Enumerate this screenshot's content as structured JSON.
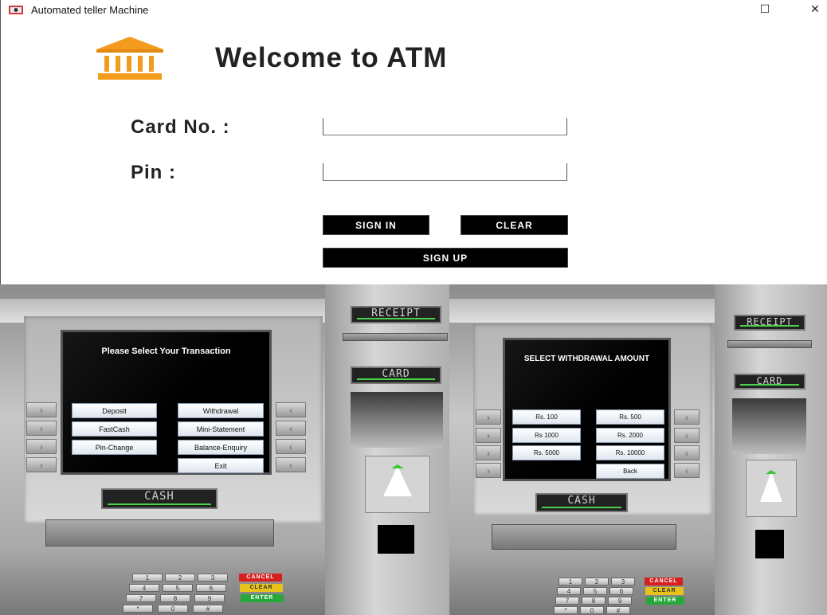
{
  "window": {
    "title": "Automated teller Machine",
    "maximize_glyph": "☐",
    "close_glyph": "✕"
  },
  "login": {
    "heading": "Welcome to ATM",
    "card_label": "Card No. :",
    "pin_label": "Pin :",
    "card_value": "",
    "pin_value": "",
    "signin_label": "SIGN IN",
    "clear_label": "CLEAR",
    "signup_label": "SIGN UP"
  },
  "atm_left": {
    "receipt_label": "RECEIPT",
    "card_label": "CARD",
    "cash_label": "CASH",
    "screen_title": "Please Select Your Transaction",
    "buttons": [
      "Deposit",
      "Withdrawal",
      "FastCash",
      "Mini-Statement",
      "Pin-Change",
      "Balance-Enquiry",
      "Exit"
    ]
  },
  "atm_right": {
    "receipt_label": "RECEIPT",
    "card_label": "CARD",
    "cash_label": "CASH",
    "screen_title": "SELECT WITHDRAWAL AMOUNT",
    "buttons": [
      "Rs. 100",
      "Rs. 500",
      "Rs 1000",
      "Rs. 2000",
      "Rs. 5000",
      "Rs. 10000",
      "Back"
    ]
  },
  "keypad": {
    "keys": [
      "1",
      "2",
      "3",
      "4",
      "5",
      "6",
      "7",
      "8",
      "9",
      "*",
      "0",
      "#"
    ],
    "cancel": "CANCEL",
    "clear": "CLEAR",
    "enter": "ENTER"
  },
  "colors": {
    "button_black": "#000000",
    "accent_green": "#4ad04a",
    "logo_orange": "#f29b1d",
    "cancel_red": "#d62020",
    "clear_yellow": "#e6c21a",
    "enter_green": "#27a83a"
  },
  "icons": [
    "app-icon",
    "bank-logo-icon",
    "maximize-icon",
    "close-icon",
    "chevron-right-icon",
    "chevron-left-icon"
  ]
}
